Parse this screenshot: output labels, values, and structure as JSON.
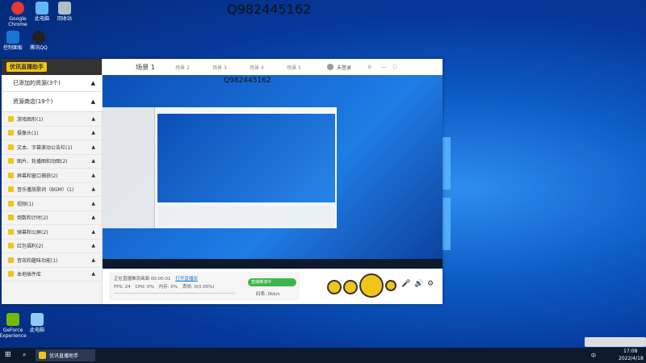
{
  "watermark": "Q982445162",
  "desktop": {
    "icons": [
      {
        "label": "Google Chrome",
        "color": "#e53935"
      },
      {
        "label": "此电脑",
        "color": "#64b5f6"
      },
      {
        "label": "回收站",
        "color": "#b0bec5"
      },
      {
        "label": "腾讯QQ",
        "color": "#212121"
      },
      {
        "label": "控制面板",
        "color": "#1976d2"
      },
      {
        "label": "GeForce Experience",
        "color": "#76b900"
      },
      {
        "label": "此电脑",
        "color": "#90caf9"
      }
    ]
  },
  "app": {
    "logo": "优讯直播助手",
    "sidebar": {
      "added": {
        "label": "已添加的资源(3个)"
      },
      "store": {
        "label": "资源商店(19个)"
      },
      "categories": [
        {
          "label": "游戏图形(1)"
        },
        {
          "label": "摄像头(1)"
        },
        {
          "label": "文本、字幕滚动公告栏(1)"
        },
        {
          "label": "图片、轮播图和动图(2)"
        },
        {
          "label": "屏幕和窗口捕获(2)"
        },
        {
          "label": "音乐播放歌词（BGM）(1)"
        },
        {
          "label": "视频(1)"
        },
        {
          "label": "倒数和计时(2)"
        },
        {
          "label": "弹幕和公屏(2)"
        },
        {
          "label": "红包福利(2)"
        },
        {
          "label": "音效和趣味功能(1)"
        },
        {
          "label": "本地插件库"
        }
      ]
    },
    "tabs": [
      "场景 1",
      "场景 2",
      "场景 3",
      "场景 4",
      "场景 5"
    ],
    "user": "未登录",
    "preview_watermark": "Q982445162",
    "status": {
      "line1": "正在直播推流画面 00:00:01",
      "link": "打开直播间",
      "fps_label": "FPS:",
      "fps": "24",
      "cpu_label": "CPU:",
      "cpu": "0%",
      "mem_label": "内存:",
      "mem": "0%",
      "drop_label": "丢帧:",
      "drop": "0(0.00%)",
      "bitrate_label": "码率:",
      "bitrate": "0kb/s",
      "toggle": "直播推流中"
    }
  },
  "taskbar": {
    "app_label": "优讯直播助手",
    "time": "17:08",
    "date": "2022/4/18",
    "ime": "中"
  }
}
